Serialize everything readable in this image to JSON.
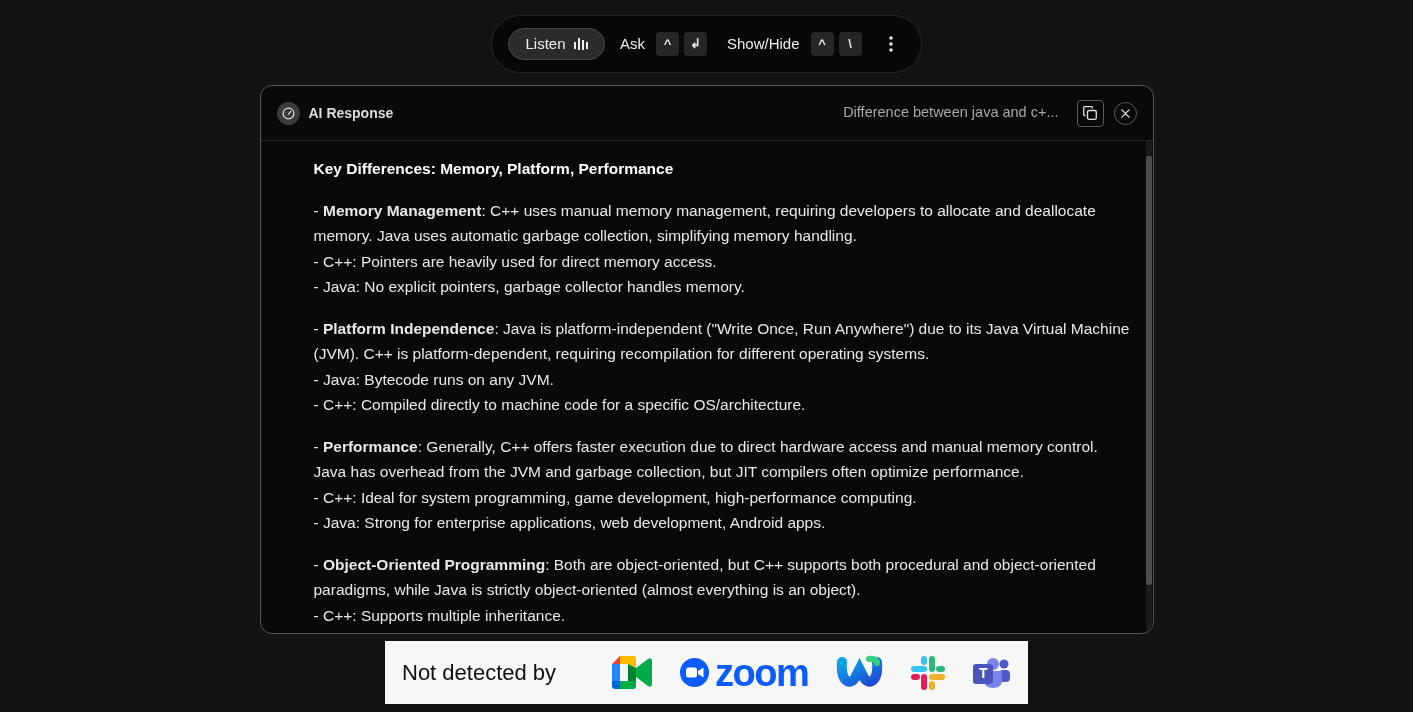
{
  "toolbar": {
    "listen_button": {
      "label": "Listen"
    },
    "shortcuts": [
      {
        "label": "Ask",
        "keys": [
          "^",
          "↲"
        ]
      },
      {
        "label": "Show/Hide",
        "keys": [
          "^",
          "\\"
        ]
      }
    ]
  },
  "response_panel": {
    "title": "AI Response",
    "query": "Difference between java and c+...",
    "heading": "Key Differences: Memory, Platform, Performance",
    "blocks": [
      [
        "- **Memory Management**: C++ uses manual memory management, requiring developers to allocate and deallocate memory. Java uses automatic garbage collection, simplifying memory handling.",
        "- C++: Pointers are heavily used for direct memory access.",
        "- Java: No explicit pointers, garbage collector handles memory."
      ],
      [
        "- **Platform Independence**: Java is platform-independent (\"Write Once, Run Anywhere\") due to its Java Virtual Machine (JVM). C++ is platform-dependent, requiring recompilation for different operating systems.",
        "- Java: Bytecode runs on any JVM.",
        "- C++: Compiled directly to machine code for a specific OS/architecture."
      ],
      [
        "- **Performance**: Generally, C++ offers faster execution due to direct hardware access and manual memory control. Java has overhead from the JVM and garbage collection, but JIT compilers often optimize performance.",
        "- C++: Ideal for system programming, game development, high-performance computing.",
        "- Java: Strong for enterprise applications, web development, Android apps."
      ],
      [
        "- **Object-Oriented Programming**: Both are object-oriented, but C++ supports both procedural and object-oriented paradigms, while Java is strictly object-oriented (almost everything is an object).",
        "- C++: Supports multiple inheritance."
      ]
    ]
  },
  "banner": {
    "label": "Not detected by",
    "logos": [
      {
        "kind": "meet"
      },
      {
        "kind": "zoom",
        "text": "zoom"
      },
      {
        "kind": "webex"
      },
      {
        "kind": "slack"
      },
      {
        "kind": "teams",
        "text": "T"
      }
    ]
  }
}
